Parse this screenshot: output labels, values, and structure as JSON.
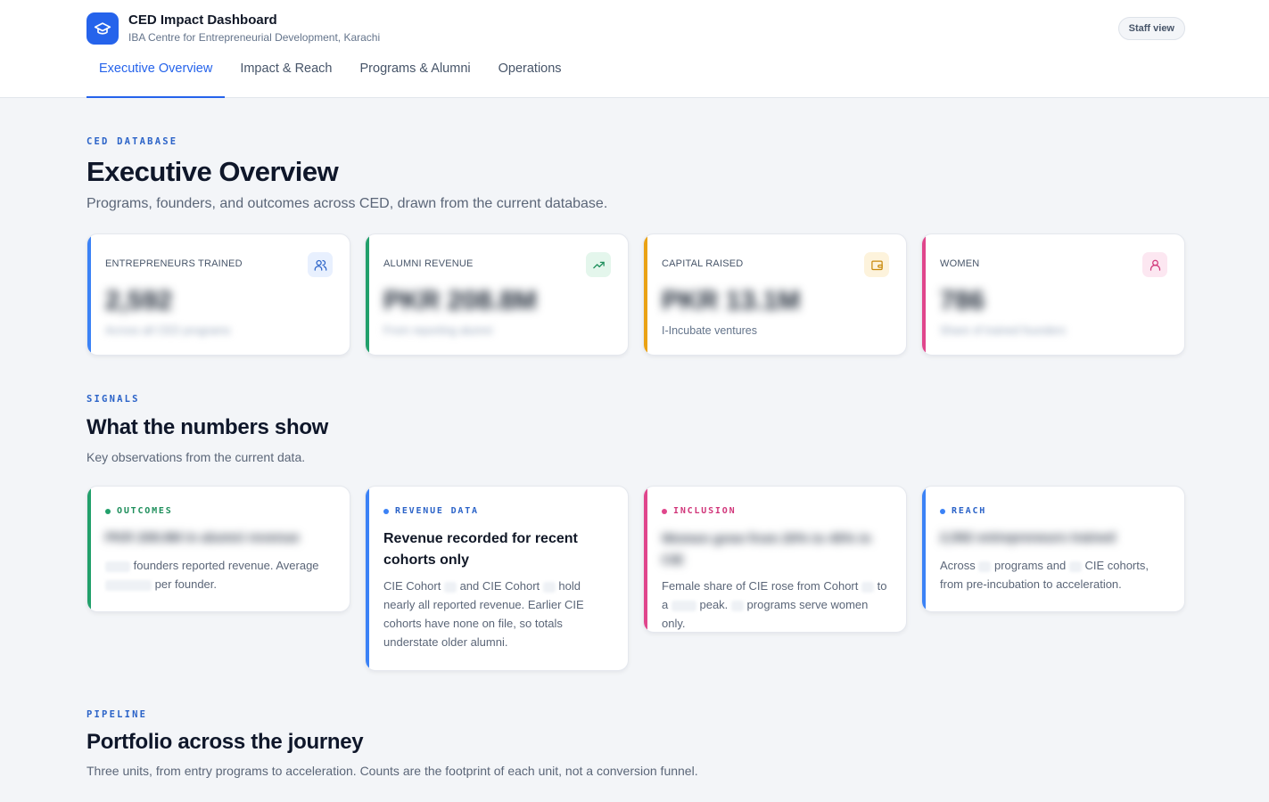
{
  "app": {
    "title": "CED Impact Dashboard",
    "subtitle": "IBA Centre for Entrepreneurial Development, Karachi",
    "logo_icon": "graduation-cap-icon",
    "staff_button": "Staff view"
  },
  "tabs": [
    {
      "label": "Executive Overview",
      "active": true
    },
    {
      "label": "Impact & Reach",
      "active": false
    },
    {
      "label": "Programs & Alumni",
      "active": false
    },
    {
      "label": "Operations",
      "active": false
    }
  ],
  "overview": {
    "eyebrow": "CED DATABASE",
    "title": "Executive Overview",
    "description": "Programs, founders, and outcomes across CED, drawn from the current database."
  },
  "stats": [
    {
      "label": "ENTREPRENEURS TRAINED",
      "value": "2,592",
      "note": "Across all CED programs",
      "icon": "users-icon",
      "color": "#3b82f6",
      "icon_bg": "#e8f0fe",
      "note_blurred": true
    },
    {
      "label": "ALUMNI REVENUE",
      "value": "PKR 208.8M",
      "note": "From reporting alumni",
      "icon": "trending-up-icon",
      "color": "#22a06b",
      "icon_bg": "#e4f6ec",
      "note_blurred": true
    },
    {
      "label": "CAPITAL RAISED",
      "value": "PKR 13.1M",
      "note": "I-Incubate ventures",
      "icon": "wallet-icon",
      "color": "#eaa214",
      "icon_bg": "#fdf3dc",
      "note_blurred": false
    },
    {
      "label": "WOMEN",
      "value": "786",
      "note": "Share of trained founders",
      "icon": "user-icon",
      "color": "#e0468c",
      "icon_bg": "#fce7f1",
      "note_blurred": true
    }
  ],
  "signals": {
    "eyebrow": "SIGNALS",
    "title": "What the numbers show",
    "description": "Key observations from the current data.",
    "cards": [
      {
        "tag": "OUTCOMES",
        "color": "#22a06b",
        "headline": "PKR 208.8M in alumni revenue",
        "body_parts": [
          "founders reported revenue. Average",
          "per founder."
        ]
      },
      {
        "tag": "REVENUE DATA",
        "color": "#3b82f6",
        "headline": "Revenue recorded for recent cohorts only",
        "body_parts": [
          "CIE Cohort",
          "and CIE Cohort",
          "hold nearly all reported revenue. Earlier CIE cohorts have none on file, so totals understate older alumni."
        ]
      },
      {
        "tag": "INCLUSION",
        "color": "#e0468c",
        "headline": "Women grew from 20% to 45% in CIE",
        "body_parts": [
          "Female share of CIE rose from Cohort",
          "to a",
          "peak.",
          "programs serve women only."
        ]
      },
      {
        "tag": "REACH",
        "color": "#3b82f6",
        "headline": "2,592 entrepreneurs trained",
        "body_parts": [
          "Across",
          "programs and",
          "CIE cohorts, from pre-incubation to acceleration."
        ]
      }
    ]
  },
  "pipeline": {
    "eyebrow": "PIPELINE",
    "title": "Portfolio across the journey",
    "description": "Three units, from entry programs to acceleration. Counts are the footprint of each unit, not a conversion funnel."
  }
}
